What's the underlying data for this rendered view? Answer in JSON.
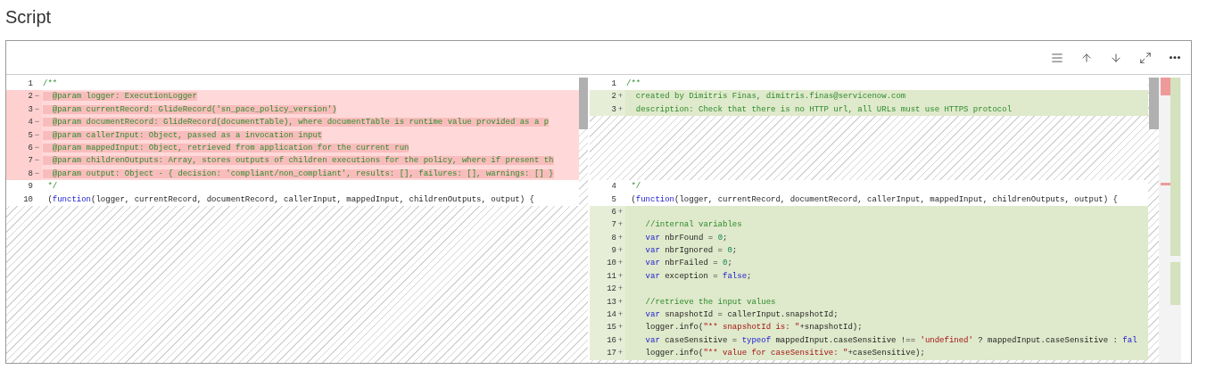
{
  "section_title": "Script",
  "toolbar": [
    {
      "kind": "lines"
    },
    {
      "kind": "up"
    },
    {
      "kind": "down"
    },
    {
      "kind": "expand"
    },
    {
      "kind": "more"
    }
  ],
  "left_pane": {
    "rows": [
      {
        "kind": "none",
        "number": "1",
        "tokens": [
          {
            "kind": "comment",
            "text": "/**"
          }
        ]
      },
      {
        "kind": "removed",
        "number": "2",
        "marker": "−",
        "tokens": [
          {
            "kind": "comment",
            "text": "  @param logger: ExecutionLogger"
          }
        ]
      },
      {
        "kind": "removed",
        "number": "3",
        "marker": "−",
        "tokens": [
          {
            "kind": "comment",
            "text": "  @param currentRecord: GlideRecord('sn_pace_policy_version')"
          }
        ]
      },
      {
        "kind": "removed",
        "number": "4",
        "marker": "−",
        "tokens": [
          {
            "kind": "comment",
            "text": "  @param documentRecord: GlideRecord(documentTable), where documentTable is runtime value provided as a p"
          }
        ]
      },
      {
        "kind": "removed",
        "number": "5",
        "marker": "−",
        "tokens": [
          {
            "kind": "comment",
            "text": "  @param callerInput: Object, passed as a invocation input"
          }
        ]
      },
      {
        "kind": "removed",
        "number": "6",
        "marker": "−",
        "tokens": [
          {
            "kind": "comment",
            "text": "  @param mappedInput: Object, retrieved from application for the current run"
          }
        ]
      },
      {
        "kind": "removed",
        "number": "7",
        "marker": "−",
        "tokens": [
          {
            "kind": "comment",
            "text": "  @param childrenOutputs: Array, stores outputs of children executions for the policy, where if present th"
          }
        ]
      },
      {
        "kind": "removed",
        "number": "8",
        "marker": "−",
        "tokens": [
          {
            "kind": "comment",
            "text": "  @param output: Object - { decision: 'compliant/non_compliant', results: [], failures: [], warnings: [] }"
          }
        ]
      },
      {
        "kind": "none",
        "number": "9",
        "tokens": [
          {
            "kind": "comment",
            "text": " */"
          }
        ]
      },
      {
        "kind": "none",
        "number": "10",
        "tokens": [
          {
            "kind": "plain",
            "text": " ("
          },
          {
            "kind": "keyword",
            "text": "function"
          },
          {
            "kind": "plain",
            "text": "(logger, currentRecord, documentRecord, callerInput, mappedInput, childrenOutputs, output) {"
          }
        ]
      }
    ]
  },
  "right_pane": {
    "rows": [
      {
        "kind": "none",
        "number": "1",
        "tokens": [
          {
            "kind": "comment",
            "text": "/**"
          }
        ]
      },
      {
        "kind": "added",
        "number": "2",
        "marker": "+",
        "tokens": [
          {
            "kind": "comment",
            "text": "  created by Dimitris Finas, dimitris.finas@servicenow.com"
          }
        ]
      },
      {
        "kind": "added",
        "number": "3",
        "marker": "+",
        "tokens": [
          {
            "kind": "comment",
            "text": "  description: Check that there is no HTTP url, all URLs must use HTTPS protocol"
          }
        ]
      },
      {
        "kind": "spacer"
      },
      {
        "kind": "spacer"
      },
      {
        "kind": "spacer"
      },
      {
        "kind": "spacer"
      },
      {
        "kind": "spacer"
      },
      {
        "kind": "none",
        "number": "4",
        "tokens": [
          {
            "kind": "comment",
            "text": " */"
          }
        ]
      },
      {
        "kind": "none",
        "number": "5",
        "tokens": [
          {
            "kind": "plain",
            "text": " ("
          },
          {
            "kind": "keyword",
            "text": "function"
          },
          {
            "kind": "plain",
            "text": "(logger, currentRecord, documentRecord, callerInput, mappedInput, childrenOutputs, output) {"
          }
        ]
      },
      {
        "kind": "added",
        "number": "6",
        "marker": "+",
        "tokens": []
      },
      {
        "kind": "added",
        "number": "7",
        "marker": "+",
        "tokens": [
          {
            "kind": "comment",
            "text": "    //internal variables"
          }
        ]
      },
      {
        "kind": "added",
        "number": "8",
        "marker": "+",
        "tokens": [
          {
            "kind": "keyword",
            "text": "    var"
          },
          {
            "kind": "plain",
            "text": " nbrFound = "
          },
          {
            "kind": "number",
            "text": "0"
          },
          {
            "kind": "plain",
            "text": ";"
          }
        ]
      },
      {
        "kind": "added",
        "number": "9",
        "marker": "+",
        "tokens": [
          {
            "kind": "keyword",
            "text": "    var"
          },
          {
            "kind": "plain",
            "text": " nbrIgnored = "
          },
          {
            "kind": "number",
            "text": "0"
          },
          {
            "kind": "plain",
            "text": ";"
          }
        ]
      },
      {
        "kind": "added",
        "number": "10",
        "marker": "+",
        "tokens": [
          {
            "kind": "keyword",
            "text": "    var"
          },
          {
            "kind": "plain",
            "text": " nbrFailed = "
          },
          {
            "kind": "number",
            "text": "0"
          },
          {
            "kind": "plain",
            "text": ";"
          }
        ]
      },
      {
        "kind": "added",
        "number": "11",
        "marker": "+",
        "tokens": [
          {
            "kind": "keyword",
            "text": "    var"
          },
          {
            "kind": "plain",
            "text": " exception = "
          },
          {
            "kind": "keyword",
            "text": "false"
          },
          {
            "kind": "plain",
            "text": ";"
          }
        ]
      },
      {
        "kind": "added",
        "number": "12",
        "marker": "+",
        "tokens": []
      },
      {
        "kind": "added",
        "number": "13",
        "marker": "+",
        "tokens": [
          {
            "kind": "comment",
            "text": "    //retrieve the input values"
          }
        ]
      },
      {
        "kind": "added",
        "number": "14",
        "marker": "+",
        "tokens": [
          {
            "kind": "keyword",
            "text": "    var"
          },
          {
            "kind": "plain",
            "text": " snapshotId = callerInput.snapshotId;"
          }
        ]
      },
      {
        "kind": "added",
        "number": "15",
        "marker": "+",
        "tokens": [
          {
            "kind": "plain",
            "text": "    logger.info("
          },
          {
            "kind": "string",
            "text": "\"** snapshotId is: \""
          },
          {
            "kind": "plain",
            "text": "+snapshotId);"
          }
        ]
      },
      {
        "kind": "added",
        "number": "16",
        "marker": "+",
        "tokens": [
          {
            "kind": "keyword",
            "text": "    var"
          },
          {
            "kind": "plain",
            "text": " caseSensitive = "
          },
          {
            "kind": "keyword",
            "text": "typeof"
          },
          {
            "kind": "plain",
            "text": " mappedInput.caseSensitive !== "
          },
          {
            "kind": "string",
            "text": "'undefined'"
          },
          {
            "kind": "plain",
            "text": " ? mappedInput.caseSensitive : "
          },
          {
            "kind": "keyword",
            "text": "fal"
          }
        ]
      },
      {
        "kind": "added",
        "number": "17",
        "marker": "+",
        "tokens": [
          {
            "kind": "plain",
            "text": "    logger.info("
          },
          {
            "kind": "string",
            "text": "\"** value for caseSensitive: \""
          },
          {
            "kind": "plain",
            "text": "+caseSensitive);"
          }
        ]
      }
    ]
  }
}
